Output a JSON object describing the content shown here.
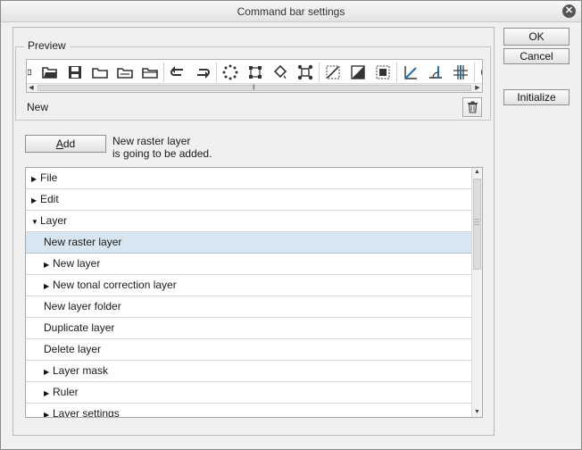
{
  "window": {
    "title": "Command bar settings"
  },
  "preview": {
    "legend": "Preview",
    "toolbar_icons": [
      "open-folder-icon",
      "save-icon",
      "folder-icon",
      "folder-icon-2",
      "folder-icon-3",
      "undo-icon",
      "redo-icon",
      "dotted-selection-icon",
      "transform-icon",
      "fill-icon",
      "bounding-box-icon",
      "clear-icon",
      "fill-diagonal-icon",
      "frame-icon",
      "ruler-icon",
      "angle-ruler-icon",
      "grid-ruler-icon",
      "help-icon"
    ],
    "selected_label": "New"
  },
  "add": {
    "button_underlined": "A",
    "button_rest": "dd",
    "description_line1": "New raster layer",
    "description_line2": "is going to be added."
  },
  "tree": {
    "rows": [
      {
        "label": "File",
        "indent": 0,
        "expander": "collapsed",
        "selected": false
      },
      {
        "label": "Edit",
        "indent": 0,
        "expander": "collapsed",
        "selected": false
      },
      {
        "label": "Layer",
        "indent": 0,
        "expander": "expanded",
        "selected": false
      },
      {
        "label": "New raster layer",
        "indent": 1,
        "expander": "none",
        "selected": true
      },
      {
        "label": "New layer",
        "indent": 1,
        "expander": "collapsed",
        "selected": false
      },
      {
        "label": "New tonal correction layer",
        "indent": 1,
        "expander": "collapsed",
        "selected": false
      },
      {
        "label": "New layer folder",
        "indent": 1,
        "expander": "none",
        "selected": false
      },
      {
        "label": "Duplicate layer",
        "indent": 1,
        "expander": "none",
        "selected": false
      },
      {
        "label": "Delete layer",
        "indent": 1,
        "expander": "none",
        "selected": false
      },
      {
        "label": "Layer mask",
        "indent": 1,
        "expander": "collapsed",
        "selected": false
      },
      {
        "label": "Ruler",
        "indent": 1,
        "expander": "collapsed",
        "selected": false
      },
      {
        "label": "Layer settings",
        "indent": 1,
        "expander": "collapsed",
        "selected": false
      }
    ]
  },
  "buttons": {
    "ok": "OK",
    "cancel": "Cancel",
    "initialize": "Initialize"
  },
  "colors": {
    "selected_row": "#d7e6f1",
    "icon_blue": "#1f6fb5",
    "icon_dark": "#333333"
  }
}
